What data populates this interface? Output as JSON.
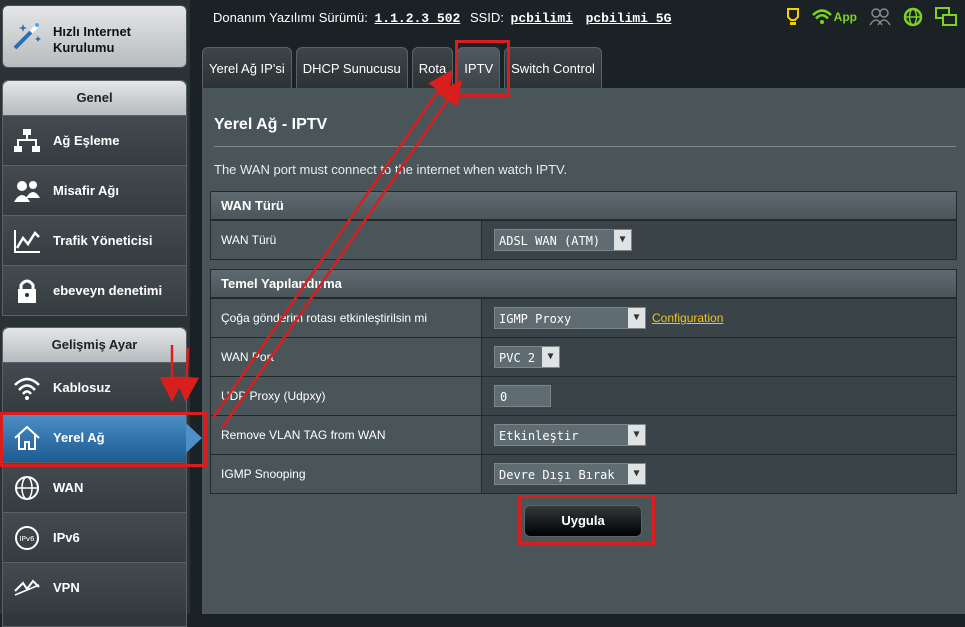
{
  "sidebar": {
    "quick_setup": "Hızlı Internet Kurulumu",
    "general": {
      "title": "Genel",
      "items": [
        {
          "label": "Ağ Eşleme",
          "icon": "network-map-icon"
        },
        {
          "label": "Misafir Ağı",
          "icon": "guest-network-icon"
        },
        {
          "label": "Trafik Yöneticisi",
          "icon": "traffic-manager-icon"
        },
        {
          "label": "ebeveyn denetimi",
          "icon": "lock-icon"
        }
      ]
    },
    "advanced": {
      "title": "Gelişmiş Ayar",
      "items": [
        {
          "label": "Kablosuz",
          "icon": "wireless-icon"
        },
        {
          "label": "Yerel Ağ",
          "icon": "home-icon"
        },
        {
          "label": "WAN",
          "icon": "globe-icon"
        },
        {
          "label": "IPv6",
          "icon": "ipv6-icon"
        },
        {
          "label": "VPN",
          "icon": "vpn-icon"
        }
      ]
    }
  },
  "topbar": {
    "fw_label": "Donanım Yazılımı Sürümü:",
    "fw_version": "1.1.2.3_502",
    "ssid_label": "SSID:",
    "ssid1": "pcbilimi",
    "ssid2": "pcbilimi_5G",
    "app_label": "App"
  },
  "tabs": [
    "Yerel Ağ IP'si",
    "DHCP Sunucusu",
    "Rota",
    "IPTV",
    "Switch Control"
  ],
  "page": {
    "title": "Yerel Ağ - IPTV",
    "description": "The WAN port must connect to the internet when watch IPTV."
  },
  "wan_section": {
    "header": "WAN Türü",
    "label": "WAN Türü",
    "value": "ADSL WAN (ATM)"
  },
  "basic_section": {
    "header": "Temel Yapılandırma",
    "rows": {
      "multicast": {
        "label": "Çoğa gönderim rotası etkinleştirilsin mi",
        "value": "IGMP Proxy",
        "link": "Configuration"
      },
      "wan_port": {
        "label": "WAN Port",
        "value": "PVC 2"
      },
      "udp_proxy": {
        "label": "UDP Proxy (Udpxy)",
        "value": "0"
      },
      "vlan_tag": {
        "label": "Remove VLAN TAG from WAN",
        "value": "Etkinleştir"
      },
      "igmp": {
        "label": "IGMP Snooping",
        "value": "Devre Dışı Bırak"
      }
    }
  },
  "apply_label": "Uygula",
  "colors": {
    "accent_blue": "#4d8fc6",
    "annotation_red": "#d91e1e",
    "link_yellow": "#f0c419",
    "app_green": "#7ed321"
  }
}
